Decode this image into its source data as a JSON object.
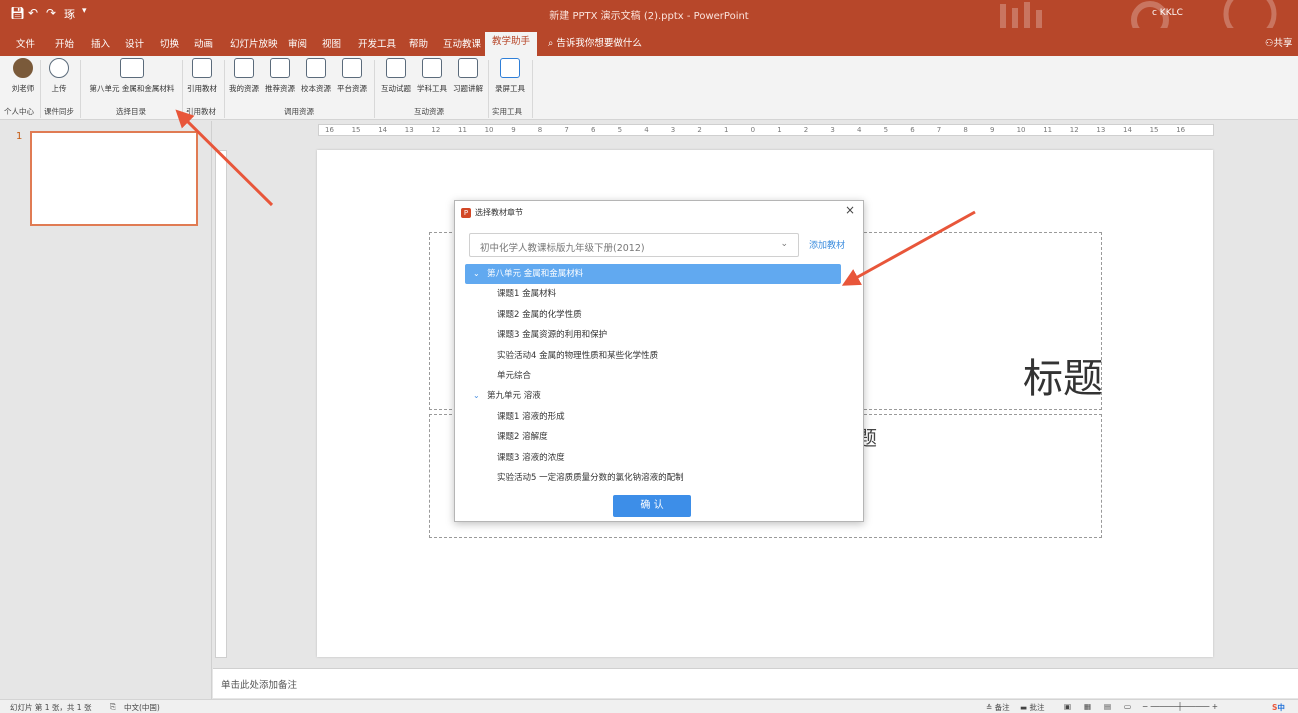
{
  "titlebar": {
    "doc_title": "新建 PPTX 演示文稿 (2).pptx  -  PowerPoint",
    "user": "c KKLC",
    "quick_access": [
      "save-icon",
      "undo-icon",
      "redo-icon",
      "touch-icon"
    ],
    "touch_label": "琢"
  },
  "menu": {
    "tabs": [
      "文件",
      "开始",
      "插入",
      "设计",
      "切换",
      "动画",
      "幻灯片放映",
      "审阅",
      "视图",
      "开发工具",
      "帮助",
      "互动教课",
      "教学助手"
    ],
    "active_tab": "教学助手",
    "tell_me": "告诉我你想要做什么",
    "share": "共享"
  },
  "ribbon": {
    "buttons": [
      {
        "label": "刘老师"
      },
      {
        "label": "上传"
      },
      {
        "label": "第八单元 金属和金属材料"
      },
      {
        "label": "引用教材"
      },
      {
        "label": "我的资源"
      },
      {
        "label": "推荐资源"
      },
      {
        "label": "校本资源"
      },
      {
        "label": "平台资源"
      },
      {
        "label": "互动试题"
      },
      {
        "label": "学科工具"
      },
      {
        "label": "习题讲解"
      },
      {
        "label": "录屏工具"
      }
    ],
    "groups": [
      "个人中心",
      "课件同步",
      "选择目录",
      "引用教材",
      "调用资源",
      "互动资源",
      "实用工具"
    ]
  },
  "slide_panel": {
    "slide_number": "1"
  },
  "ruler": {
    "labels": [
      "16",
      "15",
      "14",
      "13",
      "12",
      "11",
      "10",
      "9",
      "8",
      "7",
      "6",
      "5",
      "4",
      "3",
      "2",
      "1",
      "0",
      "1",
      "2",
      "3",
      "4",
      "5",
      "6",
      "7",
      "8",
      "9",
      "10",
      "11",
      "12",
      "13",
      "14",
      "15",
      "16"
    ]
  },
  "slide": {
    "title_text": "标题",
    "subtitle_text": "题"
  },
  "notes": {
    "placeholder": "单击此处添加备注"
  },
  "status": {
    "slide_info": "幻灯片 第 1 张，共 1 张",
    "language": "中文(中国)",
    "notes_label": "备注",
    "comments_label": "批注",
    "ime": "中"
  },
  "dialog": {
    "title": "选择教材章节",
    "close": "×",
    "textbook": "初中化学人教课标版九年级下册(2012)",
    "add_textbook": "添加教材",
    "confirm": "确 认",
    "tree": [
      {
        "label": "第八单元 金属和金属材料",
        "level": 0,
        "selected": true
      },
      {
        "label": "课题1 金属材料",
        "level": 1
      },
      {
        "label": "课题2 金属的化学性质",
        "level": 1
      },
      {
        "label": "课题3 金属资源的利用和保护",
        "level": 1
      },
      {
        "label": "实验活动4 金属的物理性质和某些化学性质",
        "level": 1
      },
      {
        "label": "单元综合",
        "level": 1
      },
      {
        "label": "第九单元 溶液",
        "level": 0
      },
      {
        "label": "课题1 溶液的形成",
        "level": 1
      },
      {
        "label": "课题2 溶解度",
        "level": 1
      },
      {
        "label": "课题3 溶液的浓度",
        "level": 1
      },
      {
        "label": "实验活动5 一定溶质质量分数的氯化钠溶液的配制",
        "level": 1
      }
    ]
  },
  "colors": {
    "brand": "#b7472a",
    "accent": "#3d8ee8",
    "selected": "#61a9f0",
    "arrow": "#e8563a"
  }
}
